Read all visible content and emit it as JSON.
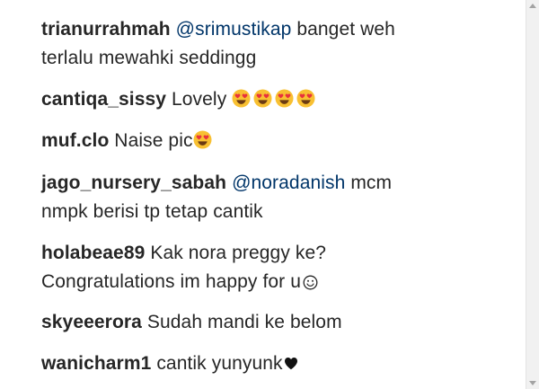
{
  "comments": [
    {
      "username": "trianurrahmah",
      "mention": "@srimustikap",
      "text_line1": " banget weh",
      "text_line2": "terlalu mewahki seddingg"
    },
    {
      "username": "cantiqa_sissy",
      "text": " Lovely ",
      "emoji": "heart-eyes-icon x4"
    },
    {
      "username": "muf.clo",
      "text": " Naise pic",
      "emoji": "heart-eyes-icon"
    },
    {
      "username": "jago_nursery_sabah",
      "mention": "@noradanish",
      "text_line1": " mcm",
      "text_line2": "nmpk berisi tp tetap cantik"
    },
    {
      "username": "holabeae89",
      "text_line1": " Kak nora preggy ke?",
      "text_line2": "Congratulations im happy for u",
      "emoji": "smiley-outline-icon"
    },
    {
      "username": "skyeeerora",
      "text": " Sudah mandi ke belom"
    },
    {
      "username": "wanicharm1",
      "text": " cantik yunyunk",
      "emoji": "black-heart-icon"
    }
  ],
  "colors": {
    "username": "#262626",
    "text": "#262626",
    "mention": "#003569",
    "emoji_face": "#f8c032",
    "emoji_heart": "#e8323c",
    "scrollbar_bg": "#f1f1f1"
  }
}
